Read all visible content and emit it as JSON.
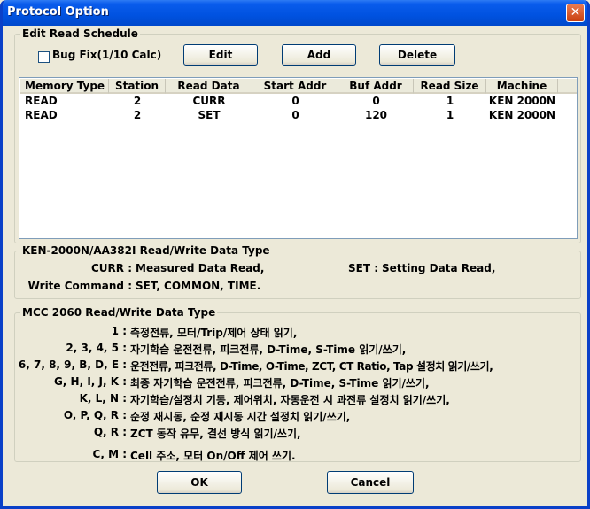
{
  "window": {
    "title": "Protocol Option",
    "close": "✕"
  },
  "schedule": {
    "legend": "Edit Read Schedule",
    "bugfix_label": "Bug Fix(1/10 Calc)",
    "edit": "Edit",
    "add": "Add",
    "delete": "Delete",
    "columns": [
      "Memory Type",
      "Station",
      "Read Data",
      "Start Addr",
      "Buf Addr",
      "Read Size",
      "Machine"
    ],
    "rows": [
      [
        "READ",
        "2",
        "CURR",
        "0",
        "0",
        "1",
        "KEN 2000N"
      ],
      [
        "READ",
        "2",
        "SET",
        "0",
        "120",
        "1",
        "KEN 2000N"
      ]
    ]
  },
  "ken": {
    "legend": "KEN-2000N/AA382I Read/Write Data Type",
    "curr_key": "CURR :",
    "curr_val": "Measured Data Read,",
    "set_key": "SET :",
    "set_val": "Setting Data Read,",
    "write_key": "Write Command :",
    "write_val": "SET, COMMON, TIME."
  },
  "mcc": {
    "legend": "MCC 2060 Read/Write Data Type",
    "lines": [
      {
        "key": "1 :",
        "val": "측정전류, 모터/Trip/제어 상태 읽기,"
      },
      {
        "key": "2, 3, 4, 5 :",
        "val": "자기학습 운전전류, 피크전류, D-Time, S-Time 읽기/쓰기,"
      },
      {
        "key": "6, 7, 8, 9, B, D, E :",
        "val": "운전전류, 피크전류, D-Time, O-Time, ZCT, CT Ratio, Tap 설정치 읽기/쓰기,"
      },
      {
        "key": "G, H, I, J, K :",
        "val": "최종 자기학습 운전전류, 피크전류, D-Time, S-Time 읽기/쓰기,"
      },
      {
        "key": "K, L, N :",
        "val": "자기학습/설정치 기동, 제어위치, 자동운전 시 과전류 설정치 읽기/쓰기,"
      },
      {
        "key": "O, P, Q, R :",
        "val": "순정 재시동, 순정 재시동 시간 설정치 읽기/쓰기,"
      },
      {
        "key": "Q, R :",
        "val": "ZCT 동작 유무, 결선 방식 읽기/쓰기,"
      },
      {
        "key": "C, M :",
        "val": "Cell 주소, 모터 On/Off 제어 쓰기."
      }
    ]
  },
  "footer": {
    "ok": "OK",
    "cancel": "Cancel"
  }
}
